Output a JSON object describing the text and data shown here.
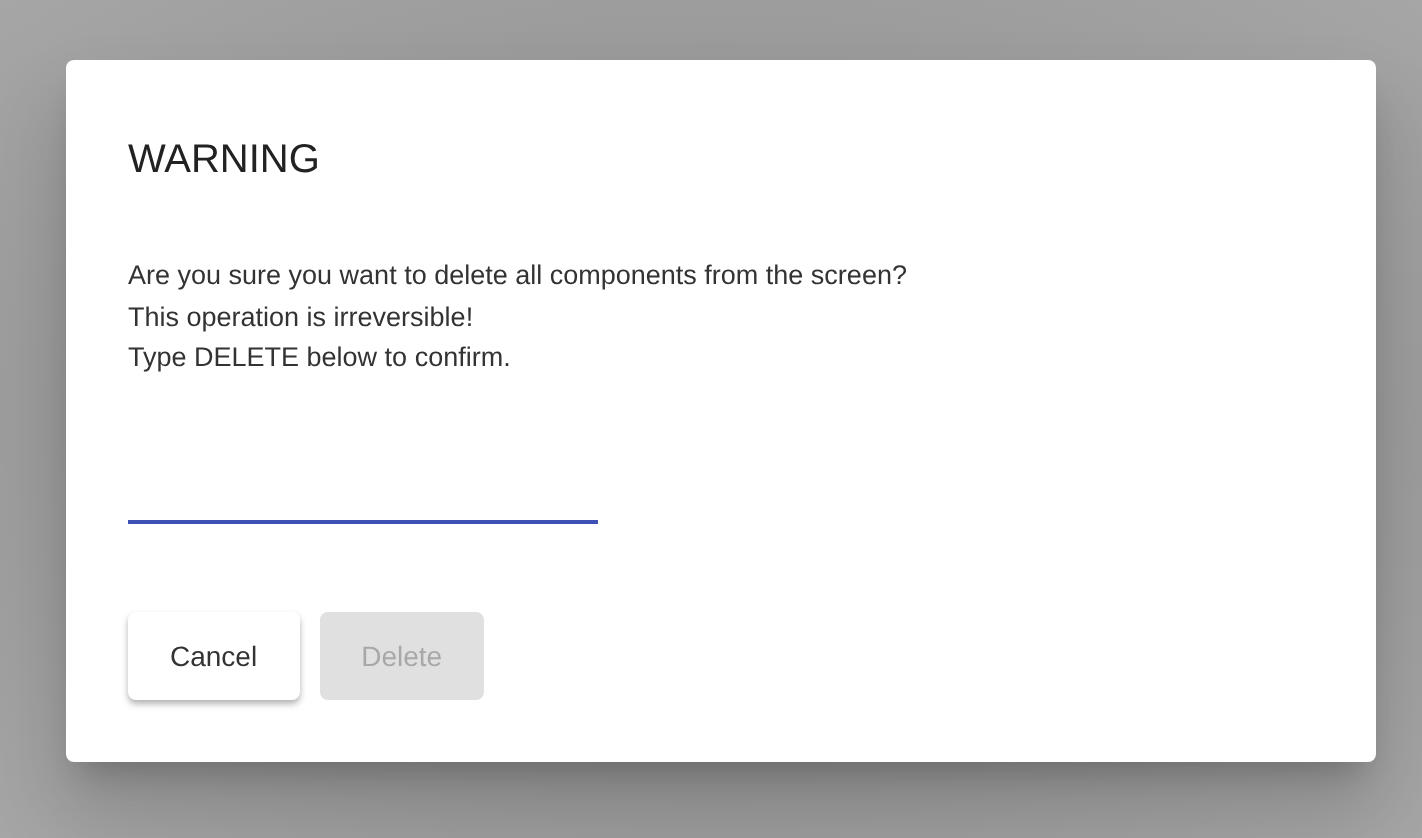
{
  "dialog": {
    "title": "WARNING",
    "message": [
      "Are you sure you want to delete all components from the screen?",
      "This operation is irreversible!",
      "Type DELETE below to confirm."
    ],
    "field": {
      "focused": true
    },
    "buttons": [
      {
        "label": "Cancel",
        "disabled": false
      },
      {
        "label": "Delete",
        "disabled": true
      }
    ]
  }
}
